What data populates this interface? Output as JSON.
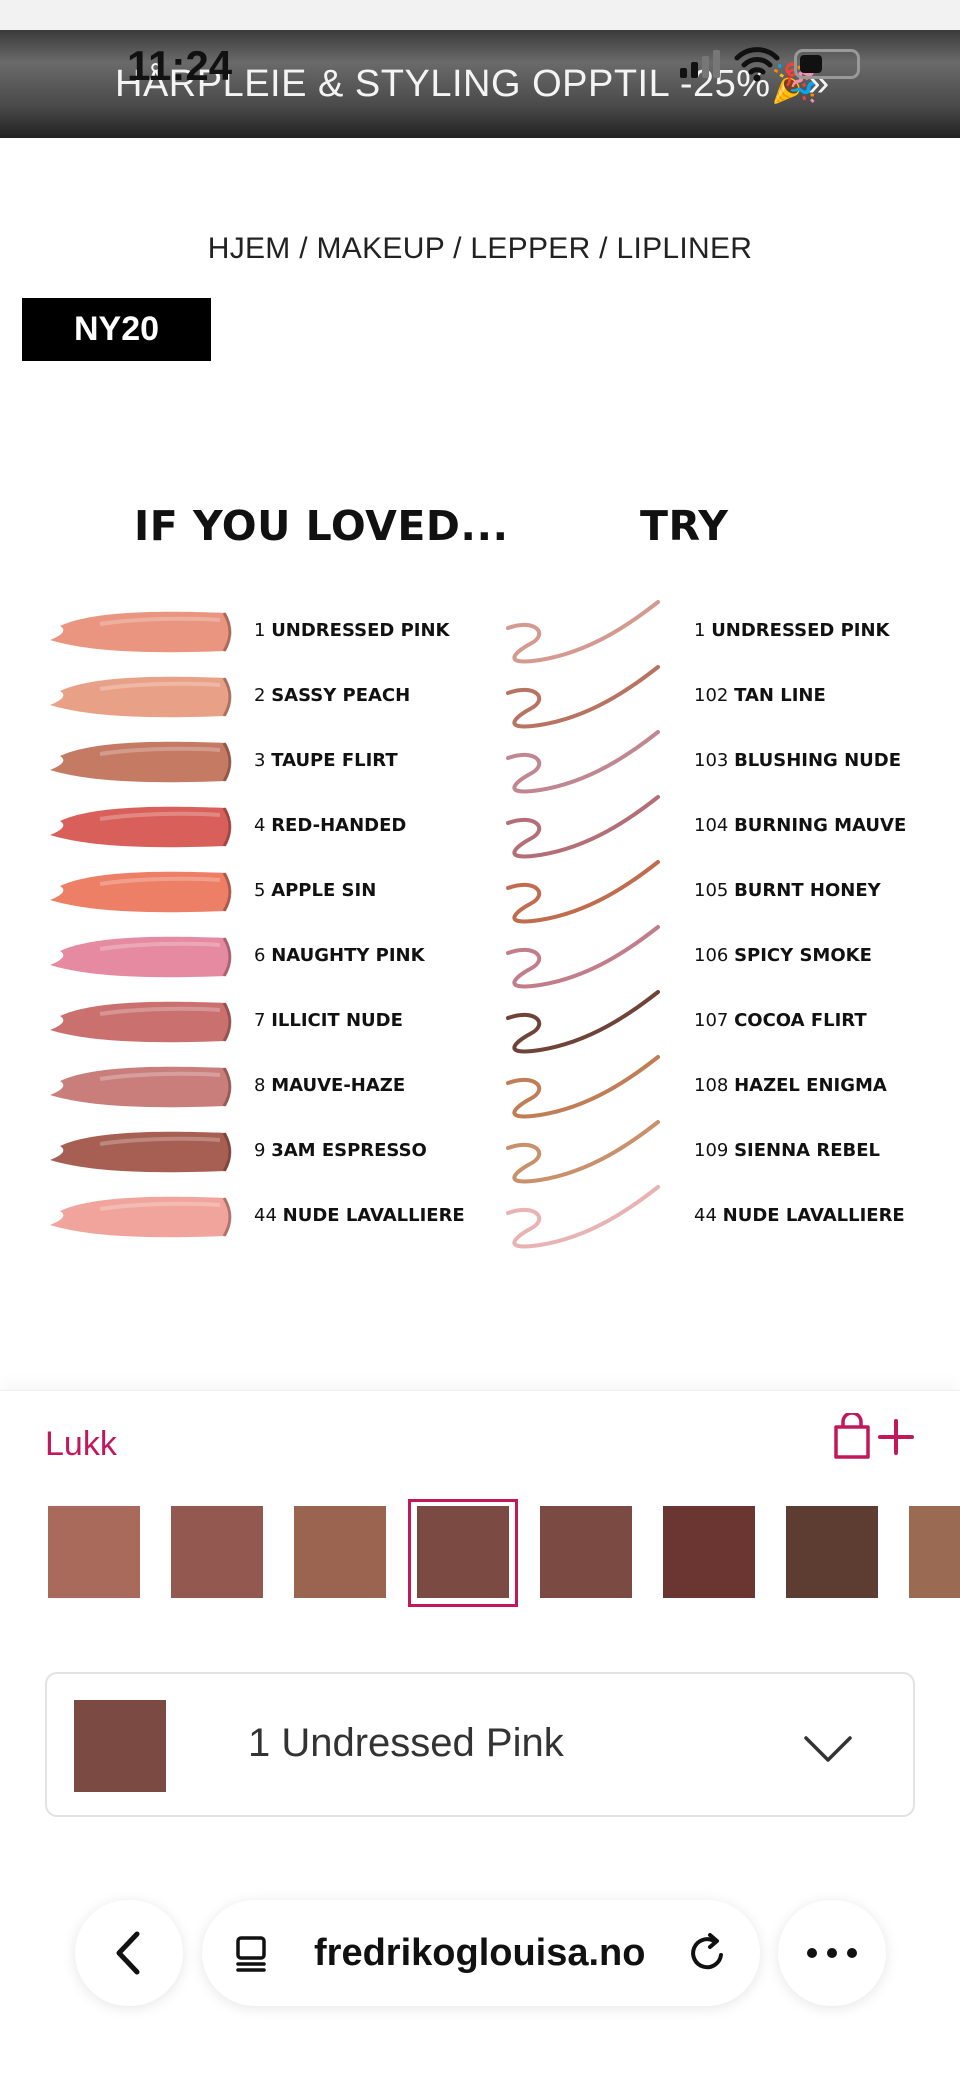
{
  "status_bar": {
    "time": "11:24"
  },
  "banner": {
    "text": "HÅRPLEIE & STYLING OPPTIL -25%🎉",
    "arrow": "»"
  },
  "breadcrumb": "HJEM / MAKEUP / LEPPER / LIPLINER",
  "badge": "NY20",
  "promo": {
    "left_heading": "IF YOU LOVED...",
    "right_heading": "TRY",
    "rows": [
      {
        "left_num": "1",
        "left_name": "UNDRESSED PINK",
        "right_num": "1",
        "right_name": "UNDRESSED PINK",
        "left_color": "#e9957f",
        "right_color": "#d49a90"
      },
      {
        "left_num": "2",
        "left_name": "SASSY PEACH",
        "right_num": "102",
        "right_name": "TAN LINE",
        "left_color": "#e8a087",
        "right_color": "#b77462"
      },
      {
        "left_num": "3",
        "left_name": "TAUPE FLIRT",
        "right_num": "103",
        "right_name": "BLUSHING NUDE",
        "left_color": "#c57a64",
        "right_color": "#c08790"
      },
      {
        "left_num": "4",
        "left_name": "RED-HANDED",
        "right_num": "104",
        "right_name": "BURNING MAUVE",
        "left_color": "#d9605a",
        "right_color": "#b46f76"
      },
      {
        "left_num": "5",
        "left_name": "APPLE SIN",
        "right_num": "105",
        "right_name": "BURNT HONEY",
        "left_color": "#ec7f66",
        "right_color": "#c06d4f"
      },
      {
        "left_num": "6",
        "left_name": "NAUGHTY PINK",
        "right_num": "106",
        "right_name": "SPICY SMOKE",
        "left_color": "#e58aa0",
        "right_color": "#c27d8a"
      },
      {
        "left_num": "7",
        "left_name": "ILLICIT NUDE",
        "right_num": "107",
        "right_name": "COCOA FLIRT",
        "left_color": "#ca7170",
        "right_color": "#6f4438"
      },
      {
        "left_num": "8",
        "left_name": "MAUVE-HAZE",
        "right_num": "108",
        "right_name": "HAZEL ENIGMA",
        "left_color": "#c97e7b",
        "right_color": "#bf7e55"
      },
      {
        "left_num": "9",
        "left_name": "3AM ESPRESSO",
        "right_num": "109",
        "right_name": "SIENNA REBEL",
        "left_color": "#a75f53",
        "right_color": "#c9916b"
      },
      {
        "left_num": "44",
        "left_name": "NUDE LAVALLIERE",
        "right_num": "44",
        "right_name": "NUDE LAVALLIERE",
        "left_color": "#f1a49c",
        "right_color": "#e9b3b4"
      }
    ]
  },
  "sheet": {
    "close_label": "Lukk",
    "accent_color": "#c2185b",
    "swatches": [
      "#a96a5c",
      "#93584f",
      "#9a6451",
      "#7b4a42",
      "#7a4a43",
      "#6b3531",
      "#5d3d32",
      "#9a6a52"
    ],
    "selected_index": 3,
    "selected_label": "1 Undressed Pink",
    "selected_color": "#7b4a42"
  },
  "browser": {
    "url": "fredrikoglouisa.no"
  },
  "icons": [
    "wifi-icon",
    "battery-icon",
    "bag-plus-icon",
    "chevron-down-icon",
    "chevron-left-icon",
    "tabs-icon",
    "reload-icon",
    "more-icon"
  ]
}
